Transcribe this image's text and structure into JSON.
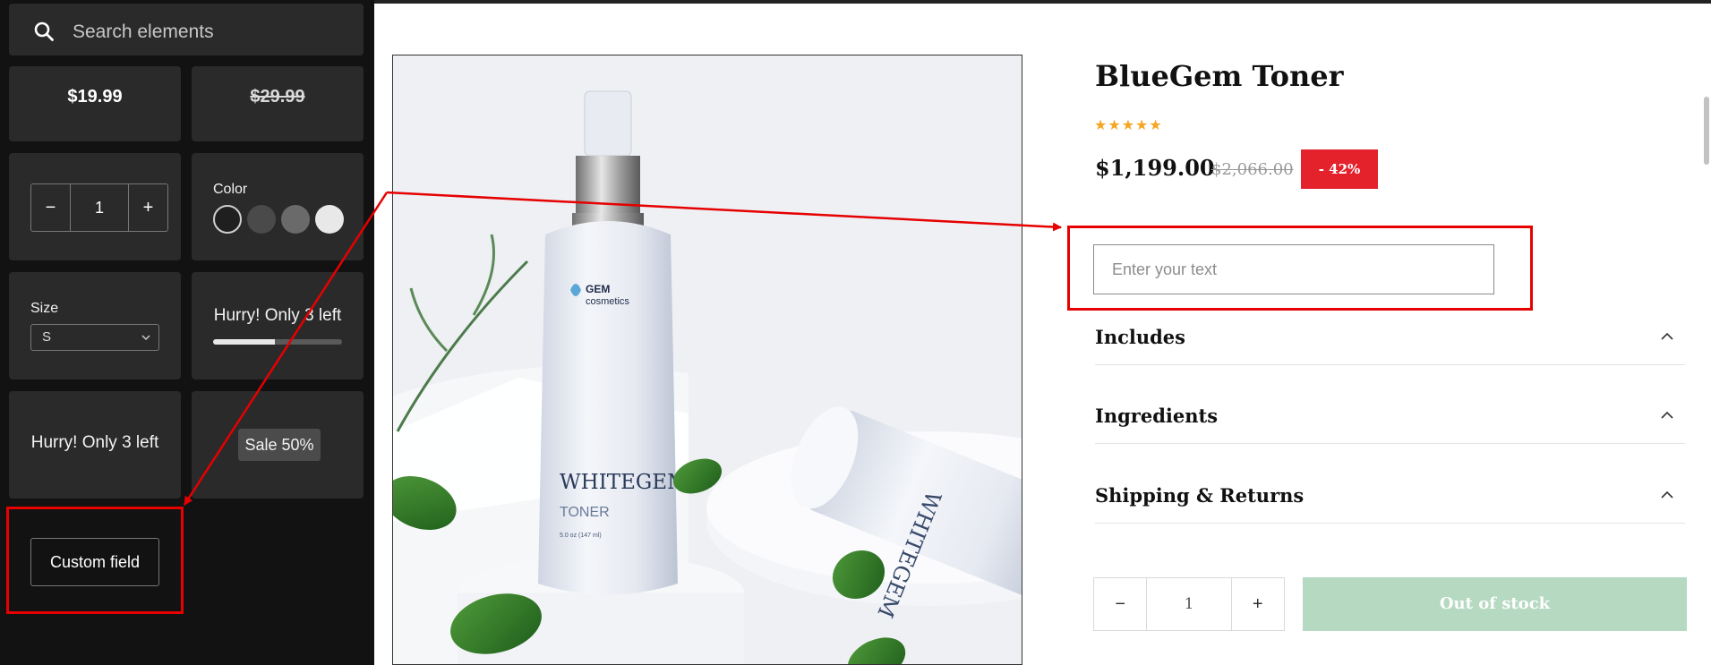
{
  "panel": {
    "search_placeholder": "Search elements",
    "price_tile": "$19.99",
    "compare_tile": "$29.99",
    "qty_tile": {
      "minus": "−",
      "value": "1",
      "plus": "+"
    },
    "color_tile": {
      "label": "Color",
      "swatches": [
        "#1f1f1f",
        "#4a4a4a",
        "#6a6a6a",
        "#e8e8e8"
      ]
    },
    "size_tile": {
      "label": "Size",
      "value": "S"
    },
    "stock_progress_tile": {
      "text": "Hurry! Only 3 left",
      "progress_percent": 48
    },
    "stock_text_tile": "Hurry! Only 3 left",
    "sale_tile": "Sale 50%",
    "custom_field_tile": "Custom field"
  },
  "product": {
    "title": "BlueGem Toner",
    "rating_stars": "★★★★★",
    "price": "$1,199.00",
    "compare_price": "$2,066.00",
    "discount": "- 42%",
    "text_field_placeholder": "Enter your text",
    "accordions": [
      "Includes",
      "Ingredients",
      "Shipping & Returns"
    ],
    "quantity": {
      "minus": "−",
      "value": "1",
      "plus": "+"
    },
    "add_button": "Out of stock",
    "image_text": {
      "brand_top": "GEM",
      "brand_bottom": "cosmetics",
      "name": "WHITEGEM",
      "type": "TONER",
      "volume": "5.0 oz (147 ml)"
    }
  },
  "colors": {
    "panel_bg": "#121212",
    "tile_bg": "#2a2a2a",
    "annotation_red": "#e60000",
    "discount_red": "#e3222c",
    "star_color": "#f5a623",
    "out_of_stock_green": "#b5d9c1"
  },
  "icons": [
    "search-icon",
    "chevron-down-icon",
    "chevron-up-icon"
  ]
}
